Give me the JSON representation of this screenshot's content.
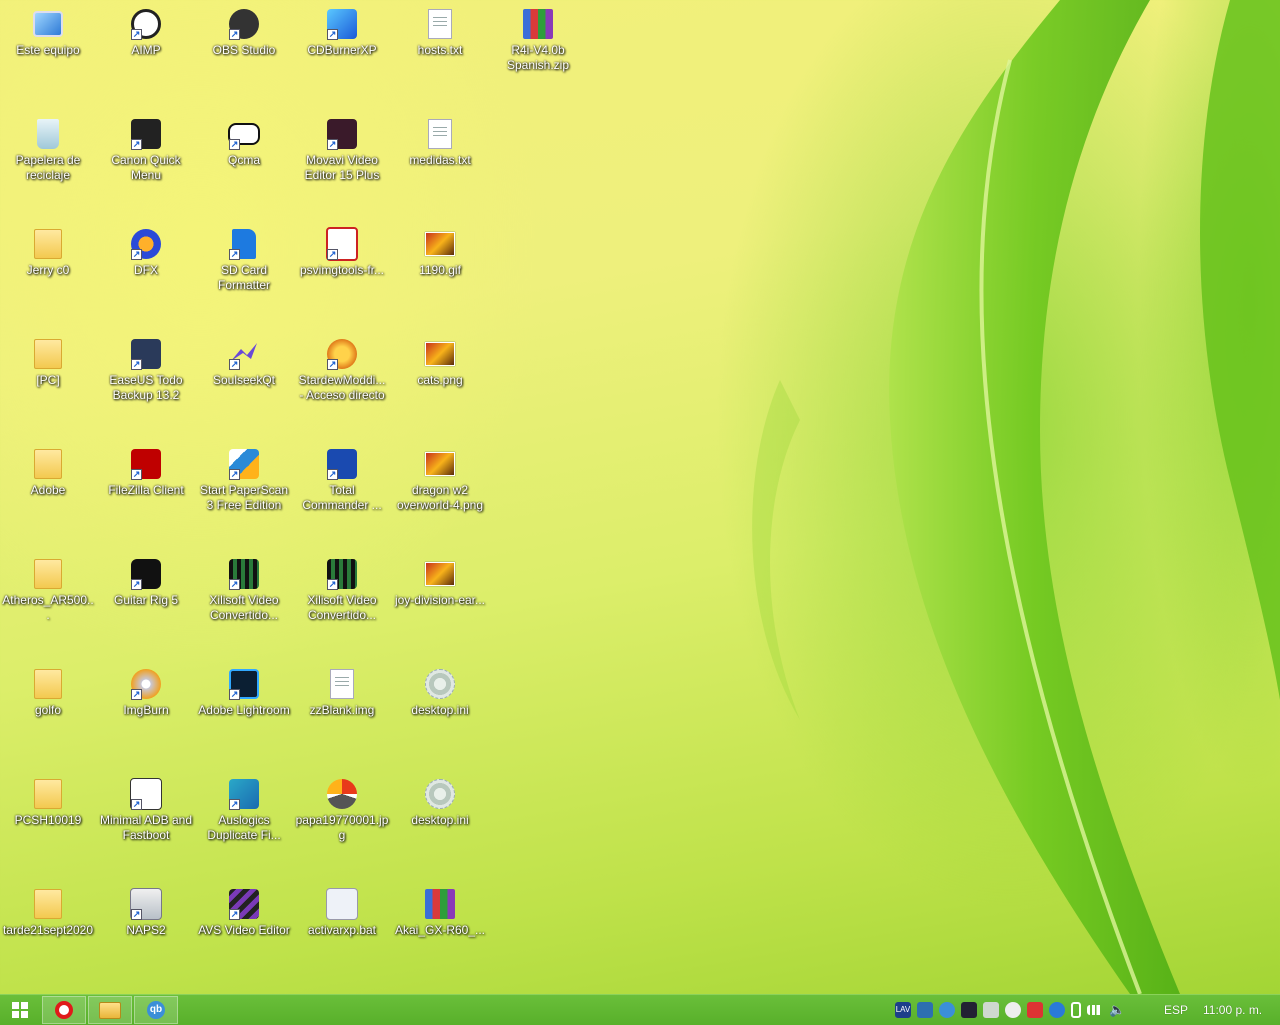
{
  "desktop": {
    "icons": [
      {
        "label": "Este equipo",
        "icon": "computer-icon"
      },
      {
        "label": "AIMP",
        "icon": "aimp-icon"
      },
      {
        "label": "OBS Studio",
        "icon": "obs-icon"
      },
      {
        "label": "CDBurnerXP",
        "icon": "cdburner-icon"
      },
      {
        "label": "hosts.txt",
        "icon": "text-file-icon"
      },
      {
        "label": "R4i-V4.0b Spanish.zip",
        "icon": "winrar-icon"
      },
      {
        "label": "Papelera de reciclaje",
        "icon": "recycle-bin-icon"
      },
      {
        "label": "Canon Quick Menu",
        "icon": "canon-icon"
      },
      {
        "label": "Qcma",
        "icon": "qcma-icon"
      },
      {
        "label": "Movavi Video Editor 15 Plus",
        "icon": "movavi-icon"
      },
      {
        "label": "medidas.txt",
        "icon": "text-file-icon"
      },
      {
        "label": "Jerry c0",
        "icon": "user-folder-icon"
      },
      {
        "label": "DFX",
        "icon": "dfx-icon"
      },
      {
        "label": "SD Card Formatter",
        "icon": "sd-card-icon"
      },
      {
        "label": "psvimgtools-fr...",
        "icon": "psvimg-icon"
      },
      {
        "label": "1190.gif",
        "icon": "image-file-icon"
      },
      {
        "label": "[PC]",
        "icon": "folder-icon"
      },
      {
        "label": "EaseUS Todo Backup 13.2",
        "icon": "easeus-icon"
      },
      {
        "label": "SoulseekQt",
        "icon": "soulseek-icon"
      },
      {
        "label": "StardewModdi... - Acceso directo",
        "icon": "stardew-icon"
      },
      {
        "label": "cats.png",
        "icon": "image-file-icon"
      },
      {
        "label": "Adobe",
        "icon": "folder-icon"
      },
      {
        "label": "FileZilla Client",
        "icon": "filezilla-icon"
      },
      {
        "label": "Start PaperScan 3 Free Edition",
        "icon": "paperscan-icon"
      },
      {
        "label": "Total Commander ...",
        "icon": "total-commander-icon"
      },
      {
        "label": "dragon w2 overworld-4.png",
        "icon": "image-file-icon"
      },
      {
        "label": "Atheros_AR500...",
        "icon": "folder-icon"
      },
      {
        "label": "Guitar Rig 5",
        "icon": "guitar-rig-icon"
      },
      {
        "label": "Xilisoft Video Convertido...",
        "icon": "xilisoft-icon"
      },
      {
        "label": "Xilisoft Video Convertido...",
        "icon": "xilisoft-icon"
      },
      {
        "label": "joy-division-ear...",
        "icon": "image-file-icon"
      },
      {
        "label": "golfo",
        "icon": "folder-icon"
      },
      {
        "label": "ImgBurn",
        "icon": "imgburn-icon"
      },
      {
        "label": "Adobe Lightroom",
        "icon": "lightroom-icon"
      },
      {
        "label": "zzBlank.img",
        "icon": "img-file-icon"
      },
      {
        "label": "desktop.ini",
        "icon": "settings-file-icon"
      },
      {
        "label": "PCSH10019",
        "icon": "folder-icon"
      },
      {
        "label": "Minimal ADB and Fastboot",
        "icon": "adb-icon"
      },
      {
        "label": "Auslogics Duplicate Fi...",
        "icon": "auslogics-icon"
      },
      {
        "label": "papa19770001.jpg",
        "icon": "jpg-file-icon"
      },
      {
        "label": "desktop.ini",
        "icon": "settings-file-icon"
      },
      {
        "label": "tarde21sept2020",
        "icon": "folder-icon"
      },
      {
        "label": "NAPS2",
        "icon": "naps2-icon"
      },
      {
        "label": "AVS Video Editor",
        "icon": "avs-icon"
      },
      {
        "label": "activarxp.bat",
        "icon": "bat-file-icon"
      },
      {
        "label": "Akai_GX-R60_...",
        "icon": "winrar-icon"
      }
    ]
  },
  "taskbar": {
    "pinned": [
      {
        "icon": "opera-icon"
      },
      {
        "icon": "file-explorer-icon"
      },
      {
        "icon": "qbittorrent-icon"
      }
    ],
    "tray": {
      "language": "ESP",
      "clock": "11:00 p. m."
    }
  },
  "colors": {
    "taskbar": "#5bb22d",
    "wallpaper_light": "#f2f07a",
    "leaf": "#7fcf2a"
  }
}
